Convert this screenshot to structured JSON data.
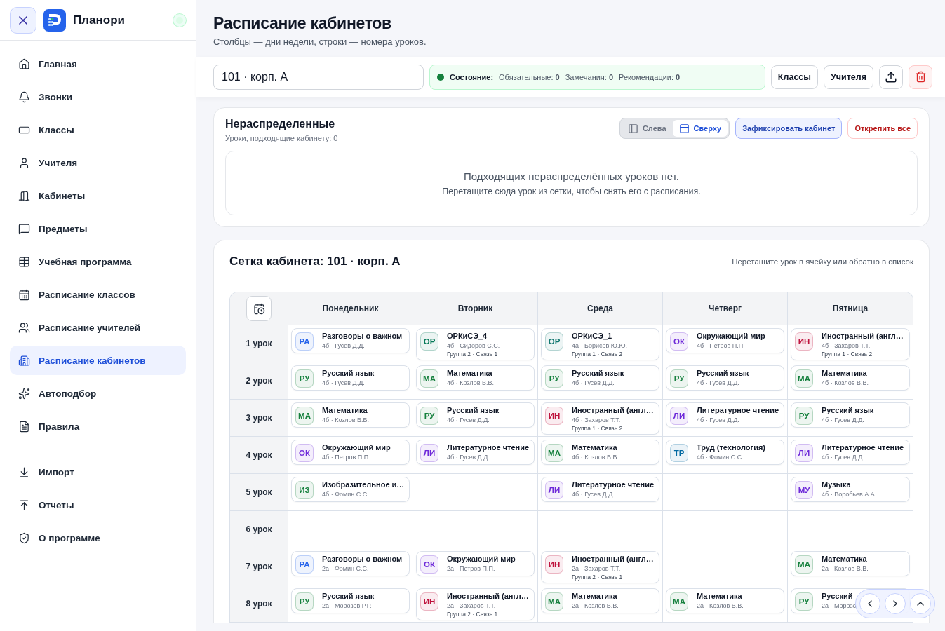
{
  "app": {
    "name": "Планори",
    "online": true
  },
  "sidebar": {
    "items": [
      {
        "label": "Главная",
        "selected": false
      },
      {
        "label": "Звонки",
        "selected": false
      },
      {
        "label": "Классы",
        "selected": false
      },
      {
        "label": "Учителя",
        "selected": false
      },
      {
        "label": "Кабинеты",
        "selected": false
      },
      {
        "label": "Предметы",
        "selected": false
      },
      {
        "label": "Учебная программа",
        "selected": false
      },
      {
        "label": "Расписание классов",
        "selected": false
      },
      {
        "label": "Расписание учителей",
        "selected": false
      },
      {
        "label": "Расписание кабинетов",
        "selected": true
      },
      {
        "label": "Автоподбор",
        "selected": false
      },
      {
        "label": "Правила",
        "selected": false
      }
    ],
    "footer_items": [
      {
        "label": "Импорт",
        "selected": false
      },
      {
        "label": "Отчеты",
        "selected": false
      },
      {
        "label": "О программе",
        "selected": false
      }
    ]
  },
  "page": {
    "title": "Расписание кабинетов",
    "subtitle": "Столбцы — дни недели, строки — номера уроков."
  },
  "toolbar": {
    "room_value": "101 · корп. А",
    "status": {
      "label": "Состояние:",
      "items": [
        "Обязательные: **0**",
        "Замечания: **0**",
        "Рекомендации: **0**"
      ]
    },
    "buttons": [
      "Классы",
      "Учителя"
    ]
  },
  "unassigned": {
    "title": "Нераспределенные",
    "subtitle": "Уроки, подходящие кабинету: 0",
    "layout_options": [
      {
        "label": "Слева",
        "selected": false
      },
      {
        "label": "Сверху",
        "selected": true
      }
    ],
    "fix_button": "Зафиксировать кабинет",
    "unpin_button": "Открепить все",
    "empty_title": "Подходящих нераспределённых уроков нет.",
    "empty_hint": "Перетащите сюда урок из сетки, чтобы снять его с расписания."
  },
  "grid": {
    "title": "Сетка кабинета: 101 · корп. А",
    "hint": "Перетащите урок в ячейку или обратно в список",
    "days": [
      "Понедельник",
      "Вторник",
      "Среда",
      "Четверг",
      "Пятница"
    ],
    "rows": [
      {
        "label": "1 урок",
        "cells": [
          {
            "abbr": "РА",
            "title": "Разговоры о важном",
            "meta": "4б · Гусев Д.Д.",
            "color": "#2563eb"
          },
          {
            "abbr": "ОР",
            "title": "ОРКиСЭ_4",
            "meta": "4б · Сидоров С.С.",
            "extra": "Группа 2 · Связь 1",
            "color": "#047857"
          },
          {
            "abbr": "ОР",
            "title": "ОРКиСЭ_1",
            "meta": "4а · Борисов Ю.Ю.",
            "extra": "Группа 1 · Связь 2",
            "color": "#0f766e"
          },
          {
            "abbr": "ОК",
            "title": "Окружающий мир",
            "meta": "4б · Петров П.П.",
            "color": "#6d28d9"
          },
          {
            "abbr": "ИН",
            "title": "Иностранный (англ…",
            "meta": "4б · Захаров Т.Т.",
            "extra": "Группа 1 · Связь 2",
            "color": "#be123c"
          }
        ]
      },
      {
        "label": "2 урок",
        "cells": [
          {
            "abbr": "РУ",
            "title": "Русский язык",
            "meta": "4б · Гусев Д.Д.",
            "color": "#15803d"
          },
          {
            "abbr": "МА",
            "title": "Математика",
            "meta": "4б · Козлов В.В.",
            "color": "#15803d"
          },
          {
            "abbr": "РУ",
            "title": "Русский язык",
            "meta": "4б · Гусев Д.Д.",
            "color": "#15803d"
          },
          {
            "abbr": "РУ",
            "title": "Русский язык",
            "meta": "4б · Гусев Д.Д.",
            "color": "#15803d"
          },
          {
            "abbr": "МА",
            "title": "Математика",
            "meta": "4б · Козлов В.В.",
            "color": "#15803d"
          }
        ]
      },
      {
        "label": "3 урок",
        "cells": [
          {
            "abbr": "МА",
            "title": "Математика",
            "meta": "4б · Козлов В.В.",
            "color": "#15803d"
          },
          {
            "abbr": "РУ",
            "title": "Русский язык",
            "meta": "4б · Гусев Д.Д.",
            "color": "#15803d"
          },
          {
            "abbr": "ИН",
            "title": "Иностранный (англ…",
            "meta": "4б · Захаров Т.Т.",
            "extra": "Группа 1 · Связь 2",
            "color": "#be123c"
          },
          {
            "abbr": "ЛИ",
            "title": "Литературное чтение",
            "meta": "4б · Гусев Д.Д.",
            "color": "#6d28d9"
          },
          {
            "abbr": "РУ",
            "title": "Русский язык",
            "meta": "4б · Гусев Д.Д.",
            "color": "#15803d"
          }
        ]
      },
      {
        "label": "4 урок",
        "cells": [
          {
            "abbr": "ОК",
            "title": "Окружающий мир",
            "meta": "4б · Петров П.П.",
            "color": "#6d28d9"
          },
          {
            "abbr": "ЛИ",
            "title": "Литературное чтение",
            "meta": "4б · Гусев Д.Д.",
            "color": "#6d28d9"
          },
          {
            "abbr": "МА",
            "title": "Математика",
            "meta": "4б · Козлов В.В.",
            "color": "#15803d"
          },
          {
            "abbr": "ТР",
            "title": "Труд (технология)",
            "meta": "4б · Фомин С.С.",
            "color": "#0369a1"
          },
          {
            "abbr": "ЛИ",
            "title": "Литературное чтение",
            "meta": "4б · Гусев Д.Д.",
            "color": "#6d28d9"
          }
        ]
      },
      {
        "label": "5 урок",
        "cells": [
          {
            "abbr": "ИЗ",
            "title": "Изобразительное и…",
            "meta": "4б · Фомин С.С.",
            "color": "#15803d"
          },
          null,
          {
            "abbr": "ЛИ",
            "title": "Литературное чтение",
            "meta": "4б · Гусев Д.Д.",
            "color": "#6d28d9"
          },
          null,
          {
            "abbr": "МУ",
            "title": "Музыка",
            "meta": "4б · Воробьев А.А.",
            "color": "#6d28d9"
          }
        ]
      },
      {
        "label": "6 урок",
        "cells": [
          null,
          null,
          null,
          null,
          null
        ]
      },
      {
        "label": "7 урок",
        "cells": [
          {
            "abbr": "РА",
            "title": "Разговоры о важном",
            "meta": "2а · Фомин С.С.",
            "color": "#2563eb"
          },
          {
            "abbr": "ОК",
            "title": "Окружающий мир",
            "meta": "2а · Петров П.П.",
            "color": "#6d28d9"
          },
          {
            "abbr": "ИН",
            "title": "Иностранный (англ…",
            "meta": "2а · Захаров Т.Т.",
            "extra": "Группа 2 · Связь 1",
            "color": "#be123c"
          },
          null,
          {
            "abbr": "МА",
            "title": "Математика",
            "meta": "2а · Козлов В.В.",
            "color": "#15803d"
          }
        ]
      },
      {
        "label": "8 урок",
        "cells": [
          {
            "abbr": "РУ",
            "title": "Русский язык",
            "meta": "2а · Морозов Р.Р.",
            "color": "#15803d"
          },
          {
            "abbr": "ИН",
            "title": "Иностранный (англ…",
            "meta": "2а · Захаров Т.Т.",
            "extra": "Группа 2 · Связь 1",
            "color": "#be123c"
          },
          {
            "abbr": "МА",
            "title": "Математика",
            "meta": "2а · Козлов В.В.",
            "color": "#15803d"
          },
          {
            "abbr": "МА",
            "title": "Математика",
            "meta": "2а · Козлов В.В.",
            "color": "#15803d"
          },
          {
            "abbr": "РУ",
            "title": "Русский",
            "meta": "2а · Морозо",
            "color": "#15803d"
          }
        ]
      }
    ]
  }
}
